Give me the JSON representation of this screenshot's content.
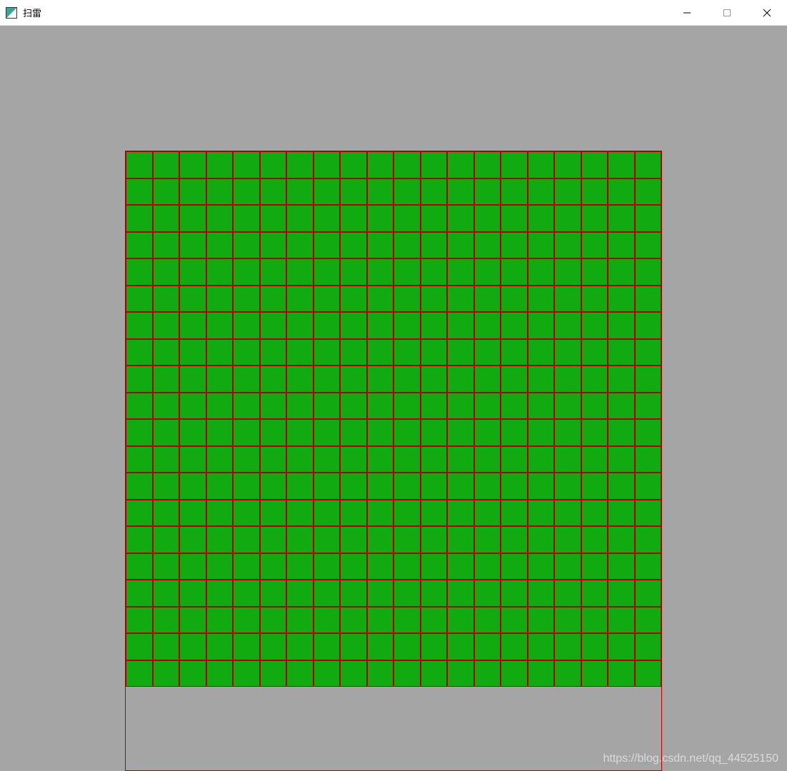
{
  "window": {
    "title": "扫雷",
    "watermark": "https://blog.csdn.net/qq_44525150"
  },
  "grid": {
    "rows": 20,
    "cols": 20,
    "cell_size_px": 37.5,
    "cell_fill": "#11aa11",
    "cell_border": "#b00000"
  },
  "colors": {
    "background": "#a5a5a5",
    "titlebar": "#ffffff"
  }
}
